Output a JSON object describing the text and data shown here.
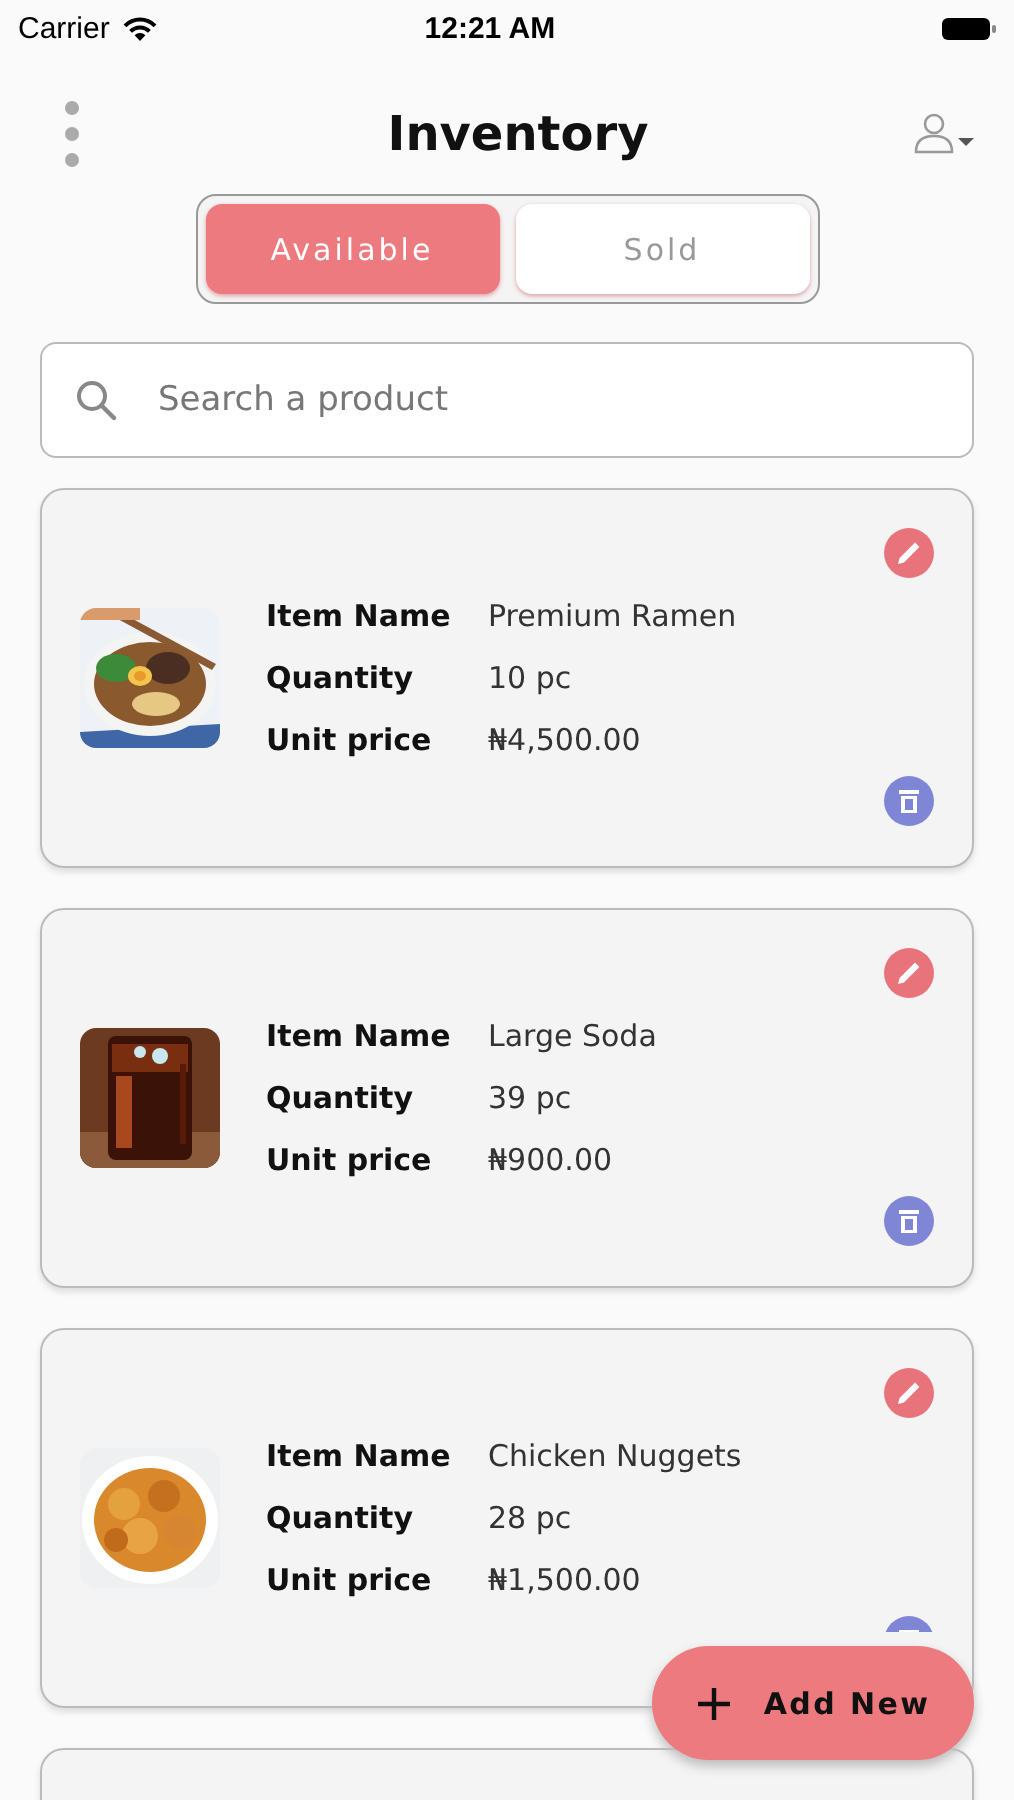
{
  "status_bar": {
    "carrier": "Carrier",
    "time": "12:21 AM"
  },
  "header": {
    "title": "Inventory"
  },
  "tabs": [
    {
      "label": "Available",
      "selected": true
    },
    {
      "label": "Sold",
      "selected": false
    }
  ],
  "search": {
    "placeholder": "Search a product"
  },
  "items": [
    {
      "kind": "product",
      "fields": [
        {
          "label": "Item Name",
          "value": "Premium Ramen"
        },
        {
          "label": "Quantity",
          "value": "10 pc"
        },
        {
          "label": "Unit price",
          "value": "₦4,500.00"
        }
      ]
    },
    {
      "kind": "product",
      "fields": [
        {
          "label": "Item Name",
          "value": "Large Soda"
        },
        {
          "label": "Quantity",
          "value": "39 pc"
        },
        {
          "label": "Unit price",
          "value": "₦900.00"
        }
      ]
    },
    {
      "kind": "product",
      "fields": [
        {
          "label": "Item Name",
          "value": "Chicken Nuggets"
        },
        {
          "label": "Quantity",
          "value": "28 pc"
        },
        {
          "label": "Unit price",
          "value": "₦1,500.00"
        }
      ]
    },
    {
      "kind": "partial"
    }
  ],
  "fab": {
    "label": "Add New"
  }
}
